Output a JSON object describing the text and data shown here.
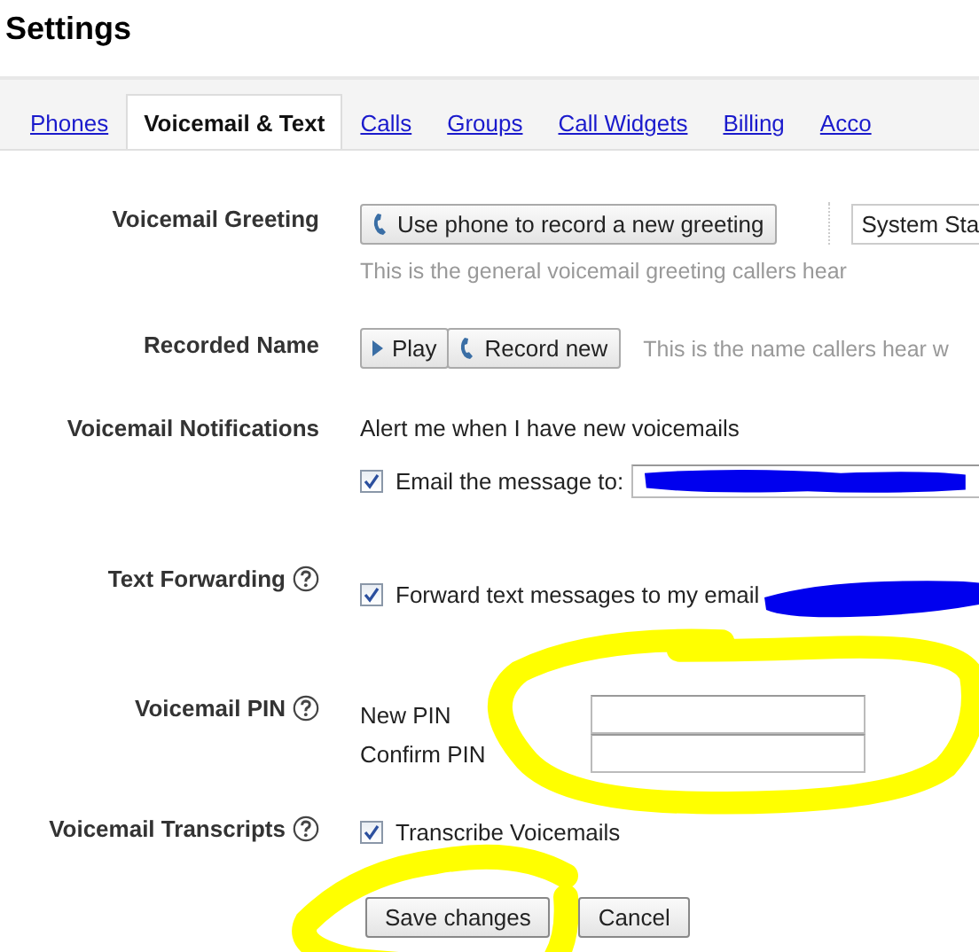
{
  "title": "Settings",
  "tabs": [
    {
      "label": "Phones",
      "selected": false
    },
    {
      "label": "Voicemail & Text",
      "selected": true
    },
    {
      "label": "Calls",
      "selected": false
    },
    {
      "label": "Groups",
      "selected": false
    },
    {
      "label": "Call Widgets",
      "selected": false
    },
    {
      "label": "Billing",
      "selected": false
    },
    {
      "label": "Acco",
      "selected": false
    }
  ],
  "sections": [
    {
      "kind": "greeting",
      "label": "Voicemail Greeting",
      "help": false,
      "button": "Use phone to record a new greeting",
      "select": "System Sta",
      "hint": "This is the general voicemail greeting callers hear"
    },
    {
      "kind": "name",
      "label": "Recorded Name",
      "help": false,
      "buttons": [
        "Play",
        "Record new"
      ],
      "hint": "This is the name callers hear w"
    },
    {
      "kind": "notify",
      "label": "Voicemail Notifications",
      "help": false,
      "text": "Alert me when I have new voicemails",
      "option": {
        "label": "Email the message to:",
        "checked": true
      },
      "redacted": true
    },
    {
      "kind": "forward",
      "label": "Text Forwarding",
      "help": true,
      "option": {
        "label": "Forward text messages to my email",
        "checked": true
      },
      "redacted": true
    },
    {
      "kind": "pin",
      "label": "Voicemail PIN",
      "help": true,
      "fields": [
        {
          "label": "New PIN"
        },
        {
          "label": "Confirm PIN"
        }
      ],
      "highlighted": true
    },
    {
      "kind": "transcripts",
      "label": "Voicemail Transcripts",
      "help": true,
      "option": {
        "label": "Transcribe Voicemails",
        "checked": true
      }
    }
  ],
  "actions": [
    {
      "label": "Save changes",
      "highlighted": true
    },
    {
      "label": "Cancel",
      "highlighted": false
    }
  ]
}
